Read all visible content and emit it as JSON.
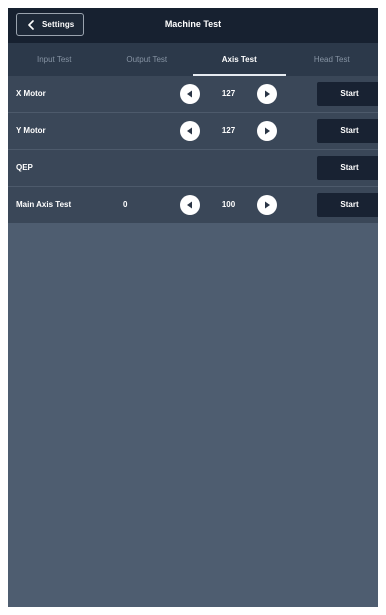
{
  "header": {
    "back_label": "Settings",
    "title": "Machine Test"
  },
  "tabs": [
    {
      "label": "Input Test",
      "active": false
    },
    {
      "label": "Output Test",
      "active": false
    },
    {
      "label": "Axis Test",
      "active": true
    },
    {
      "label": "Head Test",
      "active": false
    }
  ],
  "rows": [
    {
      "label": "X Motor",
      "value": "127",
      "start_label": "Start"
    },
    {
      "label": "Y Motor",
      "value": "127",
      "start_label": "Start"
    },
    {
      "label": "QEP",
      "start_label": "Start"
    },
    {
      "label": "Main Axis Test",
      "reading": "0",
      "value": "100",
      "start_label": "Start"
    }
  ],
  "icons": {
    "back": "chevron-left-icon",
    "decrement": "triangle-left-icon",
    "increment": "triangle-right-icon"
  },
  "colors": {
    "header_bg": "#172130",
    "tab_bar_bg": "#2c394a",
    "panel_bg": "#3a4758",
    "page_bg": "#4e5d70",
    "button_bg": "#182232",
    "active_tab_text": "#ffffff",
    "inactive_tab_text": "#8693a3"
  }
}
